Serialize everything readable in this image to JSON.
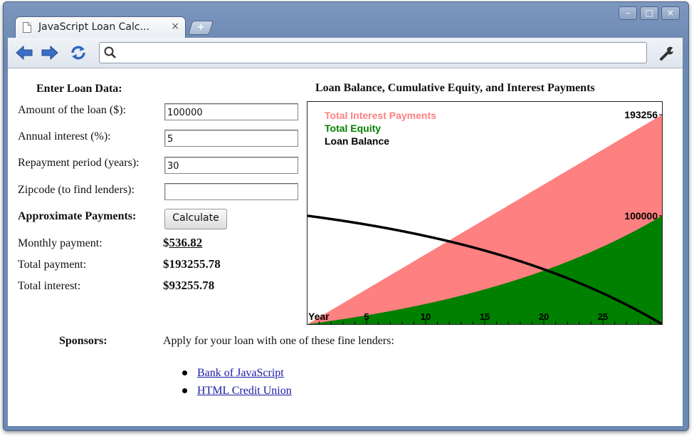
{
  "browser": {
    "tab_title": "JavaScript Loan Calc...",
    "tab_close": "×",
    "new_tab": "+",
    "address": "",
    "window_buttons": [
      "–",
      "□",
      "×"
    ]
  },
  "form": {
    "heading": "Enter Loan Data:",
    "amount_label": "Amount of the loan ($):",
    "amount_value": "100000",
    "interest_label": "Annual interest (%):",
    "interest_value": "5",
    "period_label": "Repayment period (years):",
    "period_value": "30",
    "zip_label": "Zipcode (to find lenders):",
    "zip_value": "",
    "payments_heading": "Approximate Payments:",
    "calc_button": "Calculate",
    "monthly_label": "Monthly payment:",
    "monthly_currency": "$",
    "monthly_value": "536.82",
    "total_label": "Total payment:",
    "total_value": "$193255.78",
    "interest_total_label": "Total interest:",
    "interest_total_value": "$93255.78"
  },
  "sponsors": {
    "label": "Sponsors:",
    "text": "Apply for your loan with one of these fine lenders:",
    "links": [
      "Bank of JavaScript",
      "HTML Credit Union"
    ]
  },
  "chart_data": {
    "type": "area",
    "title": "Loan Balance, Cumulative Equity, and Interest Payments",
    "x_label": "Year",
    "x_ticks": [
      5,
      10,
      15,
      20,
      25
    ],
    "xlim": [
      0,
      30
    ],
    "ylim": [
      0,
      193256
    ],
    "y_labels": [
      {
        "text": "193256",
        "value": 193256
      },
      {
        "text": "100000",
        "value": 100000
      }
    ],
    "legend": [
      {
        "name": "Total Interest Payments",
        "color": "#ff8080"
      },
      {
        "name": "Total Equity",
        "color": "#008000"
      },
      {
        "name": "Loan Balance",
        "color": "#000000"
      }
    ],
    "legend_position": "top-left",
    "loan": {
      "principal": 100000,
      "annual_rate_pct": 5,
      "years": 30,
      "monthly_payment": 536.82
    }
  },
  "colors": {
    "interest": "#ff8080",
    "equity": "#008000",
    "balance": "#000000",
    "link": "#1a1aa6"
  }
}
